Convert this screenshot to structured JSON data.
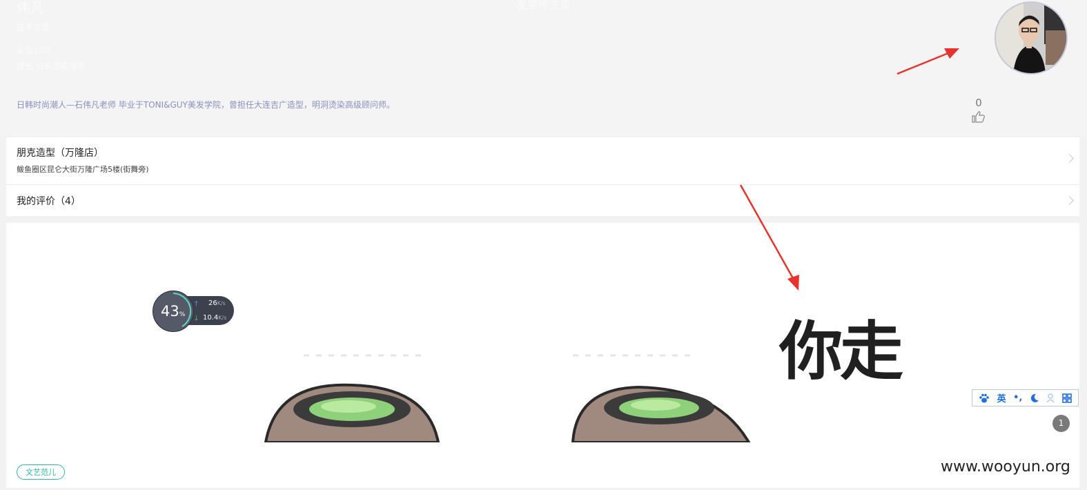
{
  "header": {
    "page_title": "发型师主页",
    "name": "伟凡",
    "role": "技术总监",
    "years": "从业10年",
    "specialty": "擅长 日系烫染接发",
    "bio": "日韩时尚潮人—石伟凡老师 毕业于TONI&GUY美发学院，曾担任大连吉广造型，明洞烫染高级顾问师。",
    "likes": "0"
  },
  "store": {
    "name": "朋克造型（万隆店）",
    "address": "鲅鱼圈区昆仑大街万隆广场5楼(街舞旁)"
  },
  "reviews": {
    "label": "我的评价（4）"
  },
  "post": {
    "caption": "你走",
    "tag": "文艺范儿",
    "page": "1"
  },
  "speed_widget": {
    "percent": "43",
    "percent_unit": "%",
    "upload": "26",
    "download": "10.4",
    "unit": "K/s"
  },
  "ime_toolbar": {
    "items": [
      "paw-icon",
      "英",
      "punctuation-icon",
      "moon-icon",
      "user-icon",
      "grid-icon"
    ],
    "lang": "英",
    "punct": "•,"
  },
  "watermark": "www.wooyun.org",
  "colors": {
    "bio": "#8a8fc0",
    "tag": "#2bb6ad",
    "annotation_arrow": "#e8322e",
    "ime_blue": "#1e6fe0"
  }
}
